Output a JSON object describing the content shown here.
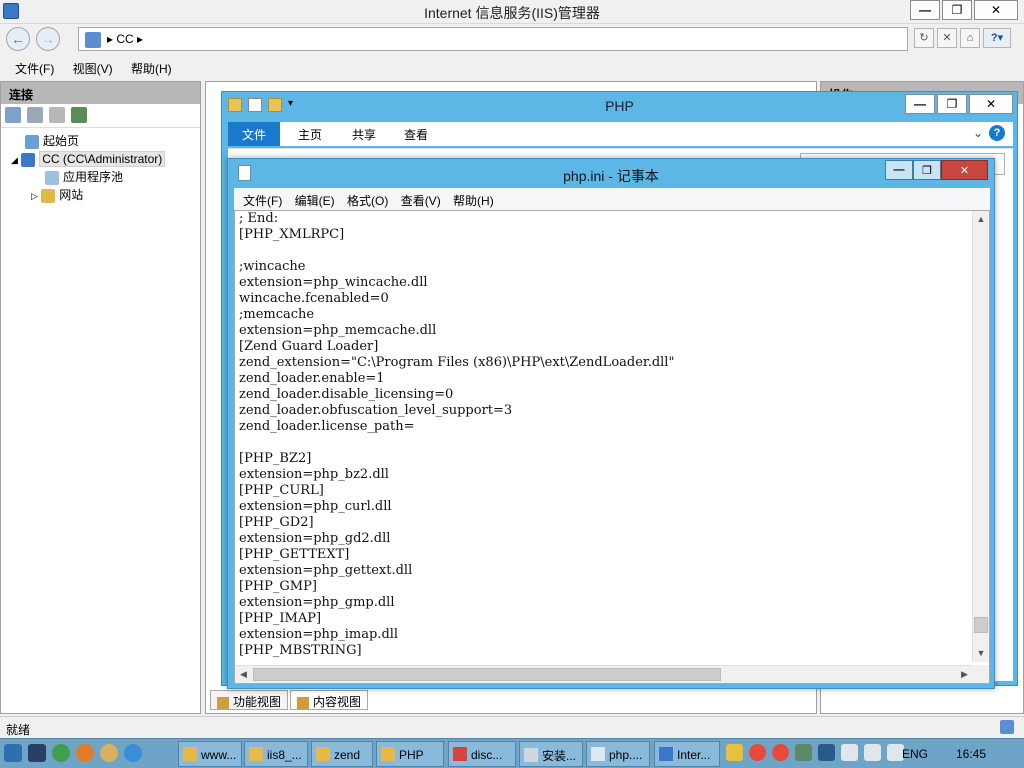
{
  "iis": {
    "title": "Internet 信息服务(IIS)管理器",
    "address": "CC",
    "menu": [
      "文件(F)",
      "视图(V)",
      "帮助(H)"
    ],
    "connections_title": "连接",
    "actions_title": "操作",
    "tree": [
      {
        "label": "起始页",
        "level": 1
      },
      {
        "label": "CC (CC\\Administrator)",
        "level": 0,
        "selected": true
      },
      {
        "label": "应用程序池",
        "level": 2
      },
      {
        "label": "网站",
        "level": 1
      }
    ],
    "bottom_tabs": [
      "功能视图",
      "内容视图"
    ],
    "status": "就绪"
  },
  "explorer": {
    "title": "PHP",
    "tabs": [
      "文件",
      "主页",
      "共享",
      "查看"
    ]
  },
  "notepad": {
    "title": "php.ini - 记事本",
    "menu": [
      "文件(F)",
      "编辑(E)",
      "格式(O)",
      "查看(V)",
      "帮助(H)"
    ],
    "lines": [
      "; End:",
      "[PHP_XMLRPC]",
      "",
      ";wincache",
      "extension=php_wincache.dll",
      "wincache.fcenabled=0",
      ";memcache",
      "extension=php_memcache.dll",
      "[Zend Guard Loader]",
      "zend_extension=\"C:\\Program Files (x86)\\PHP\\ext\\ZendLoader.dll\"",
      "zend_loader.enable=1",
      "zend_loader.disable_licensing=0",
      "zend_loader.obfuscation_level_support=3",
      "zend_loader.license_path=",
      "",
      "[PHP_BZ2]",
      "extension=php_bz2.dll",
      "[PHP_CURL]",
      "extension=php_curl.dll",
      "[PHP_GD2]",
      "extension=php_gd2.dll",
      "[PHP_GETTEXT]",
      "extension=php_gettext.dll",
      "[PHP_GMP]",
      "extension=php_gmp.dll",
      "[PHP_IMAP]",
      "extension=php_imap.dll",
      "[PHP_MBSTRING]"
    ],
    "vscroll_position": 0.97
  },
  "taskbar": {
    "items": [
      {
        "label": "www...",
        "icon_color": "#e8b84a"
      },
      {
        "label": "iis8_...",
        "icon_color": "#e8b84a"
      },
      {
        "label": "zend",
        "icon_color": "#e8b84a"
      },
      {
        "label": "PHP",
        "icon_color": "#e8b84a"
      },
      {
        "label": "disc...",
        "icon_color": "#d6453a"
      },
      {
        "label": "安装...",
        "icon_color": "#cfd8e0"
      },
      {
        "label": "php....",
        "icon_color": "#dfe8ef"
      },
      {
        "label": "Inter...",
        "icon_color": "#3a78c9"
      }
    ],
    "language": "ENG",
    "time": "16:45"
  },
  "colors": {
    "accent": "#1979ca",
    "window_frame": "#5cb6e6",
    "taskbar": "#6fa4c9",
    "close": "#c7463d"
  }
}
